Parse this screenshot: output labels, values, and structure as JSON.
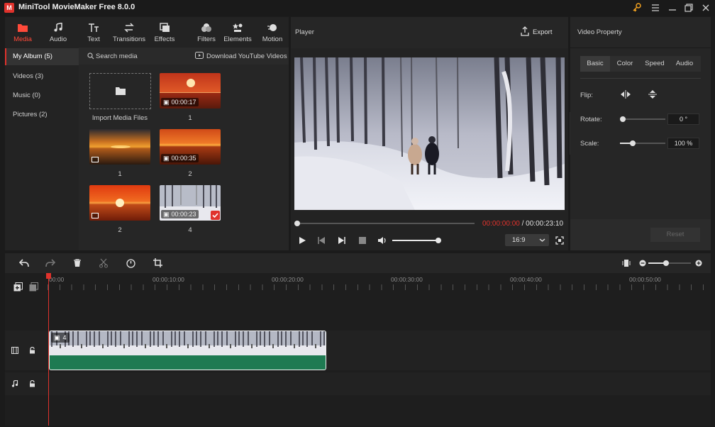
{
  "app": {
    "title": "MiniTool MovieMaker Free 8.0.0",
    "logo_letter": "M"
  },
  "tabs": [
    {
      "label": "Media",
      "icon": "folder-icon"
    },
    {
      "label": "Audio",
      "icon": "music-note-icon"
    },
    {
      "label": "Text",
      "icon": "text-icon"
    },
    {
      "label": "Transitions",
      "icon": "transitions-icon"
    },
    {
      "label": "Effects",
      "icon": "effects-icon"
    },
    {
      "label": "Filters",
      "icon": "filters-icon"
    },
    {
      "label": "Elements",
      "icon": "elements-icon"
    },
    {
      "label": "Motion",
      "icon": "motion-icon"
    }
  ],
  "sidebar": {
    "items": [
      {
        "label": "My Album (5)"
      },
      {
        "label": "Videos (3)"
      },
      {
        "label": "Music (0)"
      },
      {
        "label": "Pictures (2)"
      }
    ]
  },
  "media": {
    "search_label": "Search media",
    "download_label": "Download YouTube Videos",
    "import_label": "Import Media Files",
    "items": [
      {
        "label": "1",
        "duration": "00:00:17"
      },
      {
        "label": "1",
        "duration": ""
      },
      {
        "label": "2",
        "duration": "00:00:35"
      },
      {
        "label": "2",
        "duration": ""
      },
      {
        "label": "4",
        "duration": "00:00:23"
      }
    ]
  },
  "player": {
    "title": "Player",
    "export_label": "Export",
    "current_time": "00:00:00:00",
    "separator": " / ",
    "total_time": "00:00:23:10",
    "aspect_ratio": "16:9",
    "volume_fraction": 1.0
  },
  "property": {
    "title": "Video Property",
    "tabs": [
      "Basic",
      "Color",
      "Speed",
      "Audio"
    ],
    "flip_label": "Flip:",
    "rotate_label": "Rotate:",
    "rotate_value": "0 °",
    "scale_label": "Scale:",
    "scale_value": "100 %",
    "reset_label": "Reset"
  },
  "timeline": {
    "ruler_labels": [
      "00:00",
      "00:00:10:00",
      "00:00:20:00",
      "00:00:30:00",
      "00:00:40:00",
      "00:00:50:00"
    ],
    "clip_label": "4"
  },
  "colors": {
    "accent": "#e0322c",
    "audio_track": "#1e7a52",
    "time_current": "#e0322c"
  }
}
